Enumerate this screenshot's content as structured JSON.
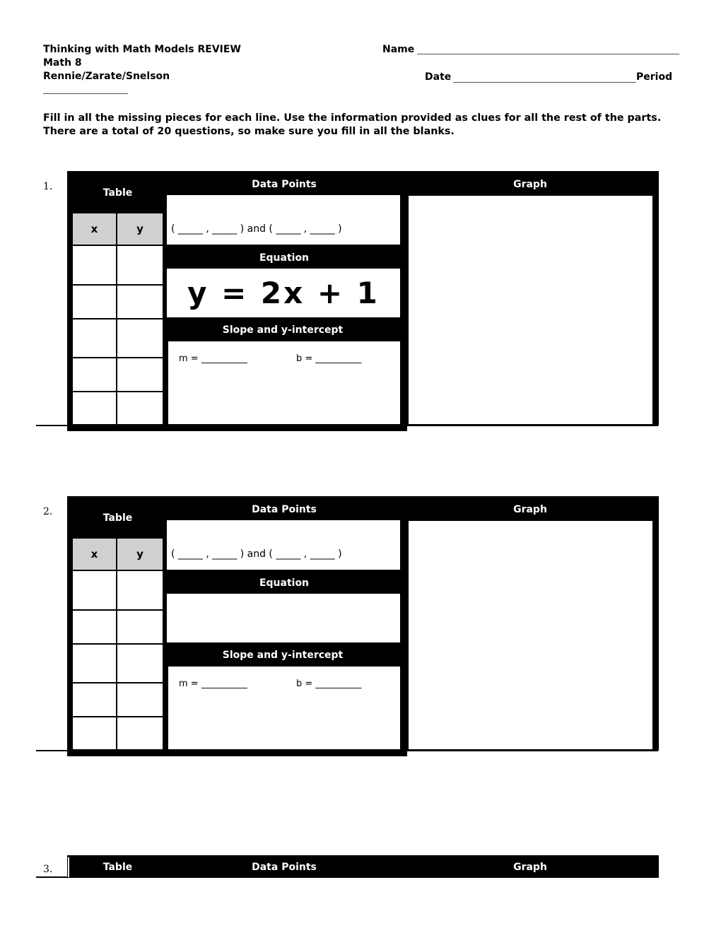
{
  "header": {
    "title": "Thinking with Math Models REVIEW",
    "course": "Math 8",
    "teachers": "Rennie/Zarate/Snelson",
    "name_label": "Name",
    "date_label": "Date",
    "period_label": "Period"
  },
  "instructions": {
    "line1": "Fill in all the missing pieces for each line. Use the information provided as clues for all the rest of the parts.",
    "line2": "There are a total of 20 questions, so make sure you fill in all the blanks."
  },
  "labels": {
    "table": "Table",
    "data_points": "Data Points",
    "graph": "Graph",
    "equation": "Equation",
    "slope_intercept": "Slope and y-intercept",
    "x_col": "x",
    "y_col": "y",
    "points_template": "( _____ , _____ ) and ( _____ , _____ )",
    "m_label": "m = __________",
    "b_label": "b = __________"
  },
  "problems": [
    {
      "number": "1.",
      "equation": "y = 2x + 1"
    },
    {
      "number": "2.",
      "equation": ""
    },
    {
      "number": "3."
    }
  ]
}
